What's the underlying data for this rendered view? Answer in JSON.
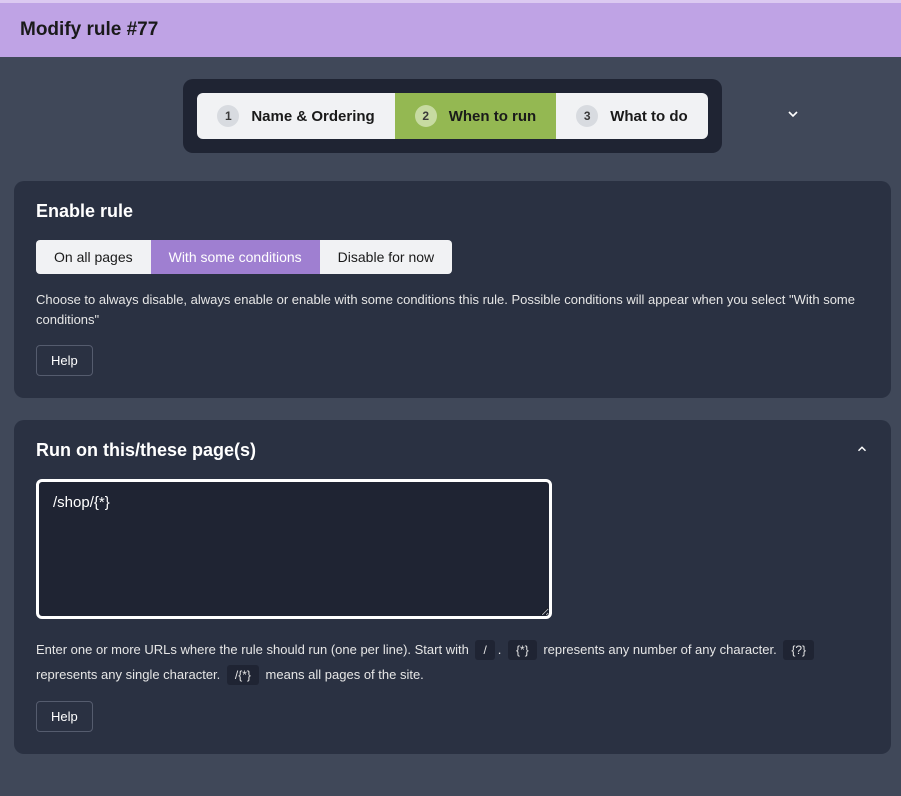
{
  "header": {
    "title": "Modify rule #77"
  },
  "stepper": {
    "steps": [
      {
        "num": "1",
        "label": "Name & Ordering",
        "active": false
      },
      {
        "num": "2",
        "label": "When to run",
        "active": true
      },
      {
        "num": "3",
        "label": "What to do",
        "active": false
      }
    ]
  },
  "enable_panel": {
    "title": "Enable rule",
    "options": {
      "all": "On all pages",
      "cond": "With some conditions",
      "disable": "Disable for now"
    },
    "desc": "Choose to always disable, always enable or enable with some conditions this rule. Possible conditions will appear when you select \"With some conditions\"",
    "help": "Help"
  },
  "run_panel": {
    "title": "Run on this/these page(s)",
    "value": "/shop/{*}",
    "desc_parts": {
      "t1": "Enter one or more URLs where the rule should run (one per line). Start with ",
      "c1": "/",
      "t2": ". ",
      "c2": "{*}",
      "t3": " represents any number of any character. ",
      "c3": "{?}",
      "t4": " represents any single character. ",
      "c4": "/{*}",
      "t5": " means all pages of the site."
    },
    "help": "Help"
  }
}
